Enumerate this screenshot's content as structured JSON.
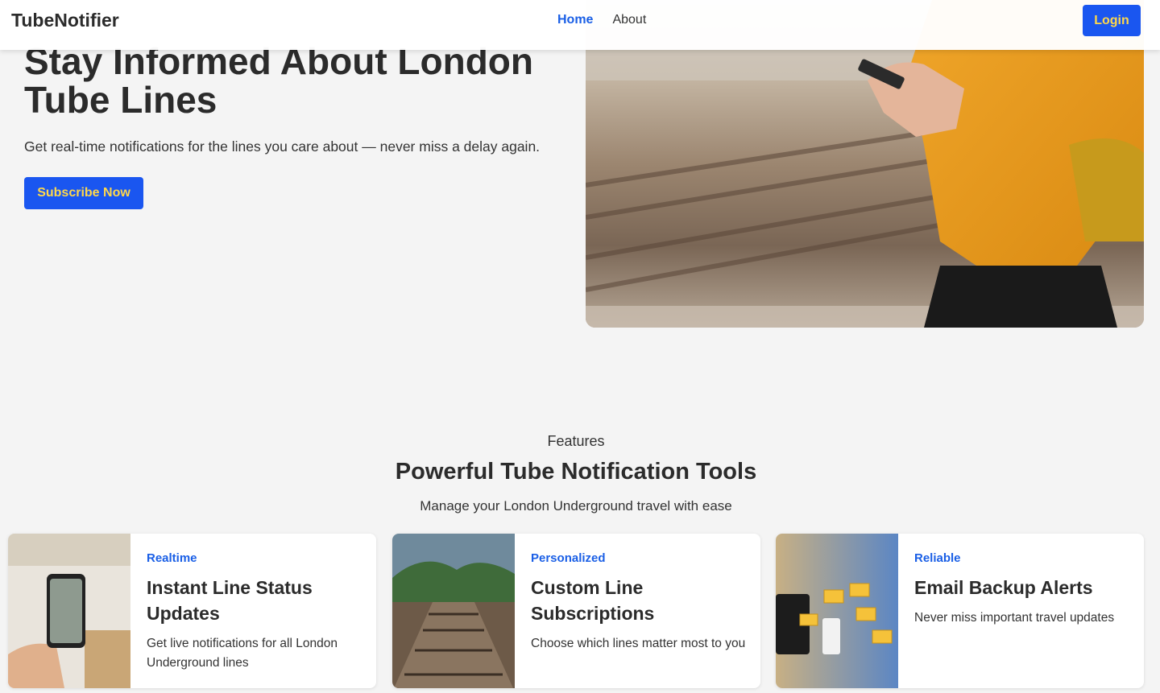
{
  "nav": {
    "brand": "TubeNotifier",
    "links": [
      {
        "label": "Home",
        "active": true
      },
      {
        "label": "About",
        "active": false
      }
    ],
    "login_label": "Login"
  },
  "hero": {
    "title": "Stay Informed About London Tube Lines",
    "subtitle": "Get real-time notifications for the lines you care about — never miss a delay again.",
    "cta_label": "Subscribe Now"
  },
  "features": {
    "eyebrow": "Features",
    "title": "Powerful Tube Notification Tools",
    "subtitle": "Manage your London Underground travel with ease",
    "cards": [
      {
        "tag": "Realtime",
        "title": "Instant Line Status Updates",
        "desc": "Get live notifications for all London Underground lines"
      },
      {
        "tag": "Personalized",
        "title": "Custom Line Subscriptions",
        "desc": "Choose which lines matter most to you"
      },
      {
        "tag": "Reliable",
        "title": "Email Backup Alerts",
        "desc": "Never miss important travel updates"
      }
    ]
  },
  "colors": {
    "accent": "#1a56f0",
    "button_text": "#ffd84a",
    "tag": "#1a5fe6",
    "background": "#f4f4f4"
  }
}
